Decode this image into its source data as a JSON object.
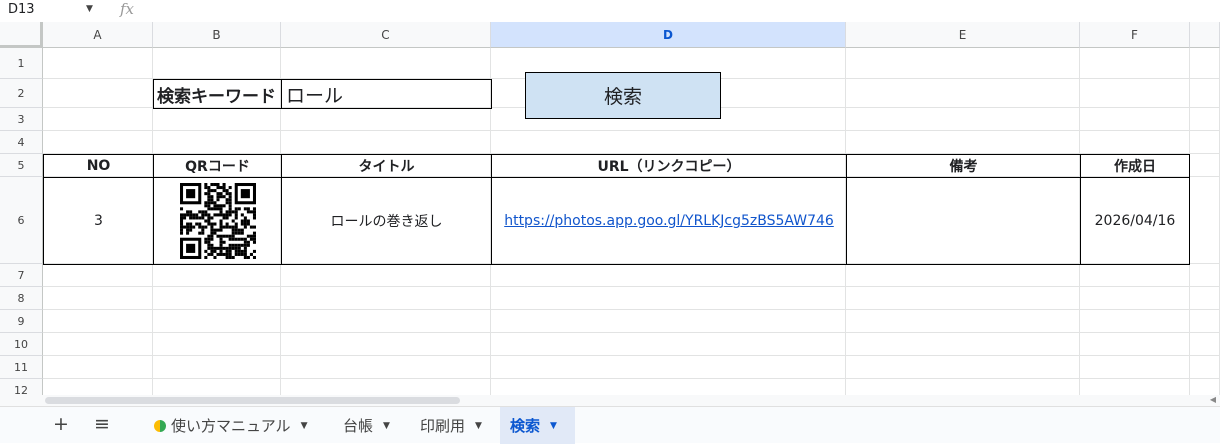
{
  "formula_bar": {
    "namebox": "D13",
    "fx": "fx"
  },
  "columns": [
    "A",
    "B",
    "C",
    "D",
    "E",
    "F"
  ],
  "rows": [
    "1",
    "2",
    "3",
    "4",
    "5",
    "6",
    "7",
    "8",
    "9",
    "10",
    "11",
    "12"
  ],
  "search": {
    "label": "検索キーワード",
    "value": "ロール",
    "button": "検索"
  },
  "table": {
    "headers": {
      "no": "NO",
      "qr": "QRコード",
      "title": "タイトル",
      "url": "URL（リンクコピー）",
      "note": "備考",
      "date": "作成日"
    },
    "rows": [
      {
        "no": "3",
        "title": "ロールの巻き返し",
        "url": "https://photos.app.goo.gl/YRLKJcg5zBS5AW746",
        "note": "",
        "date": "2026/04/16"
      }
    ]
  },
  "toolbar": {
    "add": "+",
    "menu": "≡"
  },
  "tabs": [
    {
      "label": "使い方マニュアル"
    },
    {
      "label": "台帳"
    },
    {
      "label": "印刷用"
    },
    {
      "label": "検索"
    }
  ],
  "icons": {
    "add": "plus-icon",
    "menu": "hamburger-icon",
    "beginner": "beginner-leaf-icon",
    "caret": "caret-down-icon"
  },
  "colors": {
    "selected_header": "#d3e3fd",
    "search_button": "#cfe2f3",
    "link": "#1155cc",
    "active_tab": "#e1e9f7"
  }
}
